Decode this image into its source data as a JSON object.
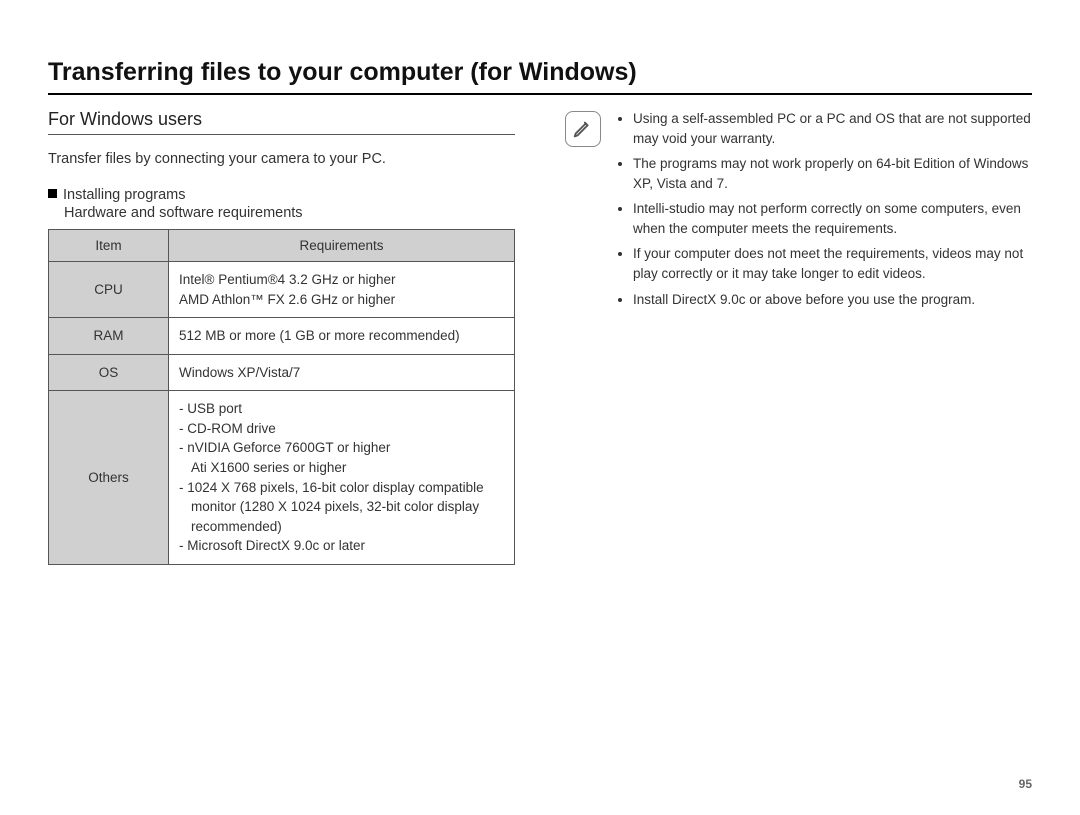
{
  "title": "Transferring files to your computer (for Windows)",
  "subhead": "For Windows users",
  "intro": "Transfer files by connecting your camera to your PC.",
  "section": {
    "heading": "Installing programs",
    "sub": "Hardware and software requirements"
  },
  "table": {
    "headers": [
      "Item",
      "Requirements"
    ],
    "rows": [
      {
        "item": "CPU",
        "lines": [
          "Intel® Pentium®4 3.2 GHz or higher",
          "AMD Athlon™ FX 2.6 GHz or higher"
        ]
      },
      {
        "item": "RAM",
        "lines": [
          "512 MB or more (1 GB or more recommended)"
        ]
      },
      {
        "item": "OS",
        "lines": [
          "Windows XP/Vista/7"
        ]
      },
      {
        "item": "Others",
        "lines": [
          "- USB port",
          "- CD-ROM drive",
          "- nVIDIA Geforce 7600GT or higher",
          "  Ati X1600 series or higher",
          "- 1024 X 768 pixels, 16-bit color display compatible",
          "  monitor (1280 X 1024 pixels, 32-bit color display",
          "  recommended)",
          "- Microsoft DirectX 9.0c or later"
        ]
      }
    ]
  },
  "notes": [
    "Using a self-assembled  PC or a PC and OS that are not supported may void your warranty.",
    "The programs may not work properly on 64-bit Edition of Windows XP, Vista and 7.",
    "Intelli-studio may not perform correctly on some computers, even when the computer meets the requirements.",
    "If your computer does not meet the requirements, videos may not play correctly or it may take longer to edit videos.",
    "Install DirectX 9.0c or above before you use the program."
  ],
  "pageNumber": "95"
}
